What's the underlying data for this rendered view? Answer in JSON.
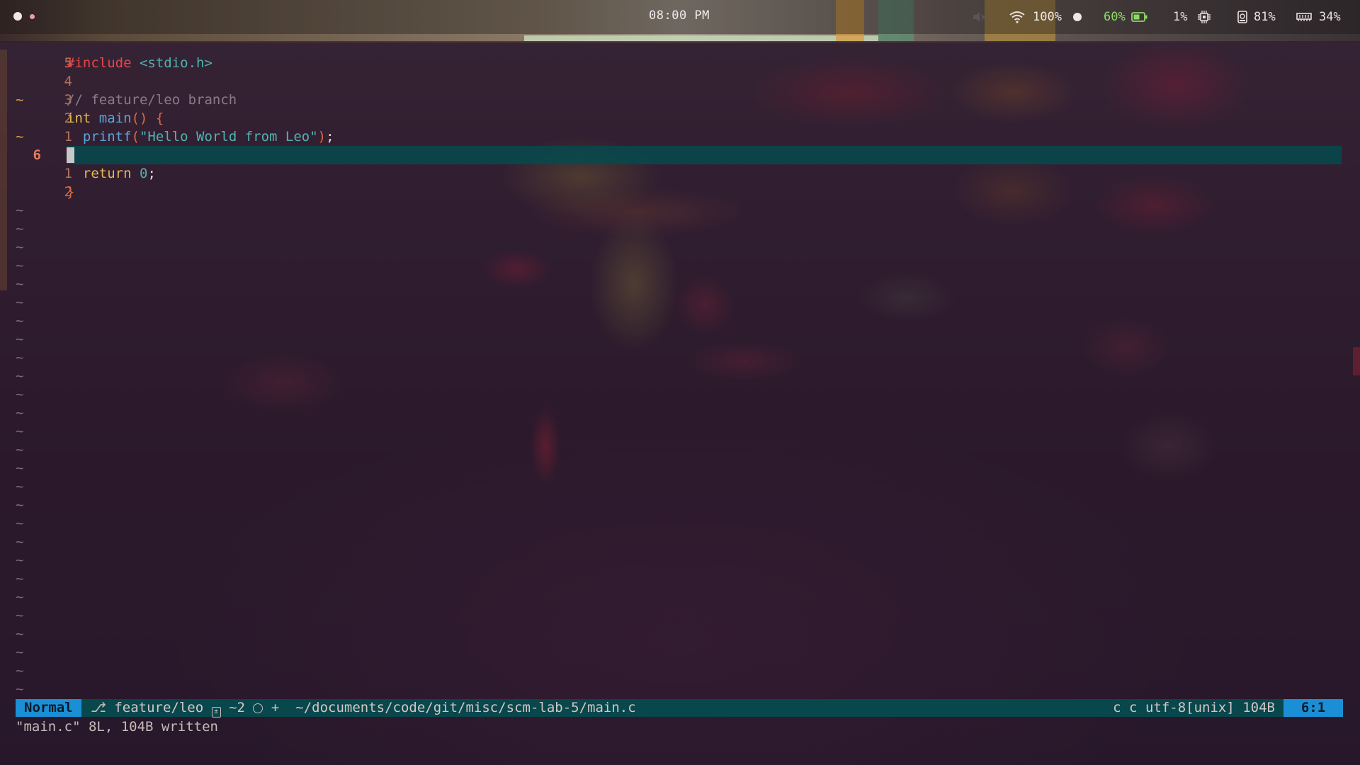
{
  "topbar": {
    "clock": "08:00 PM",
    "volume_icon": "volume-muted-icon",
    "wifi_icon": "wifi-icon",
    "wifi_strength": "100%",
    "battery_percent": "60%",
    "battery_icon": "battery-icon",
    "cpu": "1%",
    "cpu_icon": "cpu-icon",
    "disk_icon": "disk-icon",
    "disk": "81%",
    "memory_icon": "memory-icon",
    "memory": "34%"
  },
  "editor": {
    "lines": [
      {
        "sign": "",
        "num": "5",
        "parts": [
          [
            "kw-pp",
            "#include"
          ],
          [
            "plain",
            " "
          ],
          [
            "kw-inc",
            "<stdio.h>"
          ]
        ]
      },
      {
        "sign": "",
        "num": "4",
        "parts": []
      },
      {
        "sign": "~",
        "num": "3",
        "parts": [
          [
            "cmt",
            "// feature/leo branch"
          ]
        ]
      },
      {
        "sign": "",
        "num": "2",
        "parts": [
          [
            "type",
            "int"
          ],
          [
            "plain",
            " "
          ],
          [
            "fn",
            "main"
          ],
          [
            "paren",
            "()"
          ],
          [
            "plain",
            " "
          ],
          [
            "paren",
            "{"
          ]
        ]
      },
      {
        "sign": "~",
        "num": "1",
        "parts": [
          [
            "plain",
            "  "
          ],
          [
            "fn",
            "printf"
          ],
          [
            "paren",
            "("
          ],
          [
            "str",
            "\"Hello World from Leo\""
          ],
          [
            "paren",
            ")"
          ],
          [
            "plain",
            ";"
          ]
        ]
      },
      {
        "sign": "",
        "num": "6",
        "current": true,
        "parts": []
      },
      {
        "sign": "",
        "num": "1",
        "parts": [
          [
            "plain",
            "  "
          ],
          [
            "ret",
            "return"
          ],
          [
            "plain",
            " "
          ],
          [
            "num",
            "0"
          ],
          [
            "plain",
            ";"
          ]
        ]
      },
      {
        "sign": "",
        "num": "2",
        "parts": [
          [
            "paren",
            "}"
          ]
        ]
      }
    ],
    "empty_marker": "~",
    "empty_count": 27
  },
  "statusline": {
    "mode": "Normal",
    "branch_icon": "git-branch-icon",
    "branch": "feature/leo",
    "diff_icon": "diff-icon",
    "diff": "~2",
    "clock_icon": "clock-icon",
    "modified": "+",
    "path": "~/documents/code/git/misc/scm-lab-5/main.c",
    "filetype_icon": "c",
    "filetype": "c",
    "encoding": "utf-8[unix]",
    "size": "104B",
    "position": "6:1"
  },
  "cmdline": {
    "message": "\"main.c\" 8L, 104B written"
  },
  "colors": {
    "mode_bg": "#1b8fd6",
    "statusline_bg": "#064a4e",
    "line_number": "#b0745a",
    "git_sign": "#d7a24a"
  }
}
